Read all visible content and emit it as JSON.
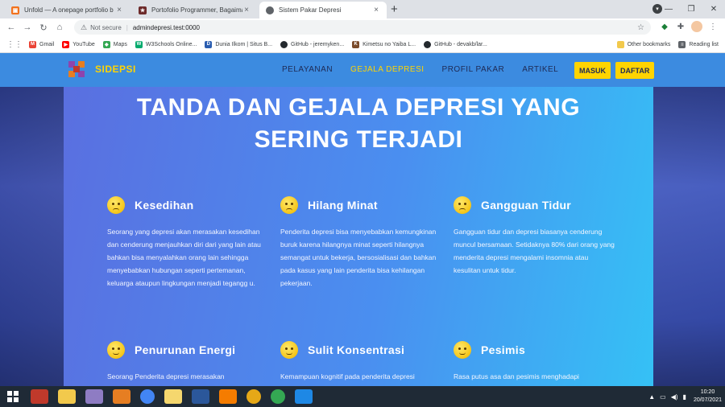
{
  "browser": {
    "tabs": [
      {
        "title": "Unfold — A onepage portfolio b",
        "active": false,
        "favicon_color": "#f2711c"
      },
      {
        "title": "Portofolio Programmer, Bagaima",
        "active": false,
        "favicon_color": "#6d2a2a"
      },
      {
        "title": "Sistem Pakar Depresi",
        "active": true,
        "favicon_color": "#5f6368"
      }
    ],
    "new_tab_label": "+",
    "address": {
      "security_label": "Not secure",
      "url": "admindepresi.test:0000"
    },
    "bookmarks": [
      {
        "label": "Gmail",
        "color": "#ea4335",
        "glyph": "M"
      },
      {
        "label": "YouTube",
        "color": "#ff0000",
        "glyph": "▶"
      },
      {
        "label": "Maps",
        "color": "#34a853",
        "glyph": "◆"
      },
      {
        "label": "W3Schools Online...",
        "color": "#04aa6d",
        "glyph": "W"
      },
      {
        "label": "Dunia Ilkom | Situs B...",
        "color": "#2a5db0",
        "glyph": "D"
      },
      {
        "label": "GitHub - jeremyken...",
        "color": "#24292e",
        "glyph": "●"
      },
      {
        "label": "Kimetsu no Yaiba L...",
        "color": "#7a4a2a",
        "glyph": "K"
      },
      {
        "label": "GitHub - devakb/lar...",
        "color": "#24292e",
        "glyph": "●"
      }
    ],
    "bookmarks_right": [
      {
        "label": "Other bookmarks"
      },
      {
        "label": "Reading list"
      }
    ]
  },
  "site": {
    "brand": "SIDEPSI",
    "nav": [
      {
        "label": "PELAYANAN",
        "active": false
      },
      {
        "label": "GEJALA DEPRESI",
        "active": true
      },
      {
        "label": "PROFIL PAKAR",
        "active": false
      },
      {
        "label": "ARTIKEL",
        "active": false
      }
    ],
    "login_label": "MASUK",
    "register_label": "DAFTAR",
    "hero_title": "TANDA DAN GEJALA DEPRESI YANG SERING TERJADI",
    "cards": [
      {
        "title": "Kesedihan",
        "icon": "crying-face-icon",
        "text": "Seorang yang depresi akan merasakan kesedihan dan cenderung menjauhkan diri dari yang lain atau bahkan bisa menyalahkan orang lain sehingga menyebabkan hubungan seperti pertemanan, keluarga ataupun lingkungan menjadi tegangg u."
      },
      {
        "title": "Hilang Minat",
        "icon": "unamused-face-icon",
        "text": "Penderita depresi bisa menyebabkan kemungkinan buruk karena hilangnya minat seperti hilangnya semangat untuk bekerja, bersosialisasi dan bahkan pada kasus yang lain penderita bisa kehilangan pekerjaan."
      },
      {
        "title": "Gangguan Tidur",
        "icon": "sleepy-face-icon",
        "text": "Gangguan tidur dan depresi biasanya cenderung muncul bersamaan. Setidaknya 80% dari orang yang menderita depresi mengalami insomnia atau kesulitan untuk tidur."
      },
      {
        "title": "Penurunan Energi",
        "icon": "tired-face-icon",
        "text": "Seorang Penderita depresi merasakan"
      },
      {
        "title": "Sulit Konsentrasi",
        "icon": "confused-face-icon",
        "text": "Kemampuan kognitif pada penderita depresi"
      },
      {
        "title": "Pesimis",
        "icon": "pensive-face-icon",
        "text": "Rasa putus asa dan pesimis menghadapi"
      }
    ]
  },
  "taskbar": {
    "time": "10:20",
    "date": "20/07/2021"
  }
}
